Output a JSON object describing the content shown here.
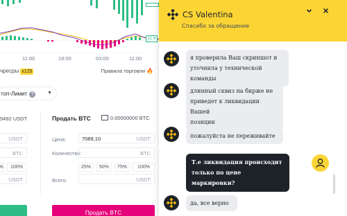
{
  "chart": {
    "price_labels": [
      "11:4"
    ],
    "time_labels": [
      "11:00",
      "19:00",
      "03:00",
      "11:00"
    ]
  },
  "futures": {
    "label": "чресры",
    "badge": "x125",
    "rules_label": "Правила торговли",
    "rules_icon": "fire-icon"
  },
  "order_type": {
    "label": "топ-Лимит"
  },
  "buy": {
    "balance": "5492 USDT",
    "price_unit": "USDT",
    "amount_unit": "BTC",
    "pct_partial": "%",
    "pct_100": "100%",
    "total_unit": "USDT"
  },
  "sell": {
    "title": "Продать BTC",
    "balance": "0.00000000 BTC",
    "price_label": "Цена:",
    "price_value": "7089,10",
    "price_unit": "USDT",
    "amount_label": "Количество:",
    "amount_unit": "BTC",
    "percents": [
      "25%",
      "50%",
      "75%",
      "100%"
    ],
    "total_label": "Всего:",
    "total_unit": "USDT",
    "button_label": "Продать BTC"
  },
  "chat": {
    "agent_name": "CS Valentina",
    "subtitle": "Спасибо за обращение",
    "messages": [
      {
        "from": "agent",
        "text_lines": [
          "я проверила Ваш скриншот и",
          "уточнила у технической команды"
        ]
      },
      {
        "from": "agent",
        "text_lines": [
          "длинный сквиз на бирже не",
          "приведет к ликвидации Вашей",
          "позиции"
        ]
      },
      {
        "from": "agent",
        "text_lines": [
          "пожалуйста не переживайте"
        ]
      },
      {
        "from": "user",
        "text_lines": [
          "Т.е ликвидация происходит",
          "только по цене маркировки?"
        ]
      },
      {
        "from": "agent",
        "text_lines": [
          "да, все верно"
        ]
      }
    ]
  },
  "colors": {
    "brand_yellow": "#fcd535",
    "buy_green": "#2ebd85",
    "sell_pink": "#e6007a",
    "dark": "#1e2329"
  }
}
